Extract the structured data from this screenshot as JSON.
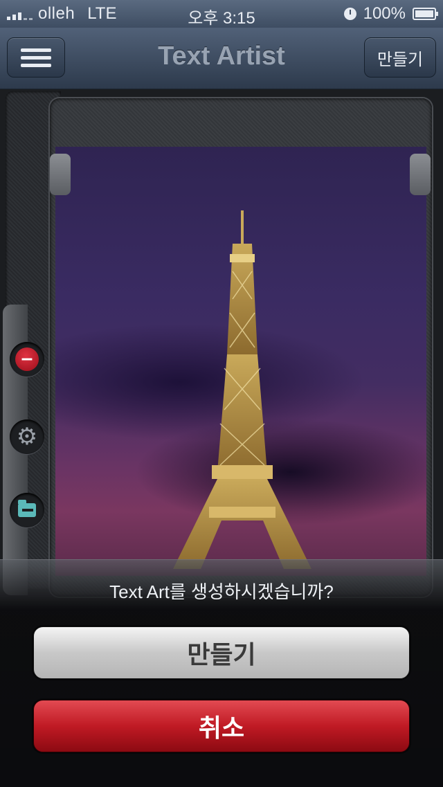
{
  "status_bar": {
    "carrier": "olleh",
    "network": "LTE",
    "time": "오후 3:15",
    "battery": "100%"
  },
  "navbar": {
    "title": "Text Artist",
    "make_label": "만들기"
  },
  "tools": [
    {
      "icon": "remove-icon",
      "glyph": "–"
    },
    {
      "icon": "gear-icon",
      "glyph": "⚙"
    },
    {
      "icon": "folder-icon"
    }
  ],
  "dialog": {
    "message": "Text Art를 생성하시겠습니까?",
    "confirm_label": "만들기",
    "cancel_label": "취소"
  },
  "colors": {
    "confirm": "#c8c8c8",
    "cancel": "#c01a24",
    "navbar": "#3e4d62"
  }
}
